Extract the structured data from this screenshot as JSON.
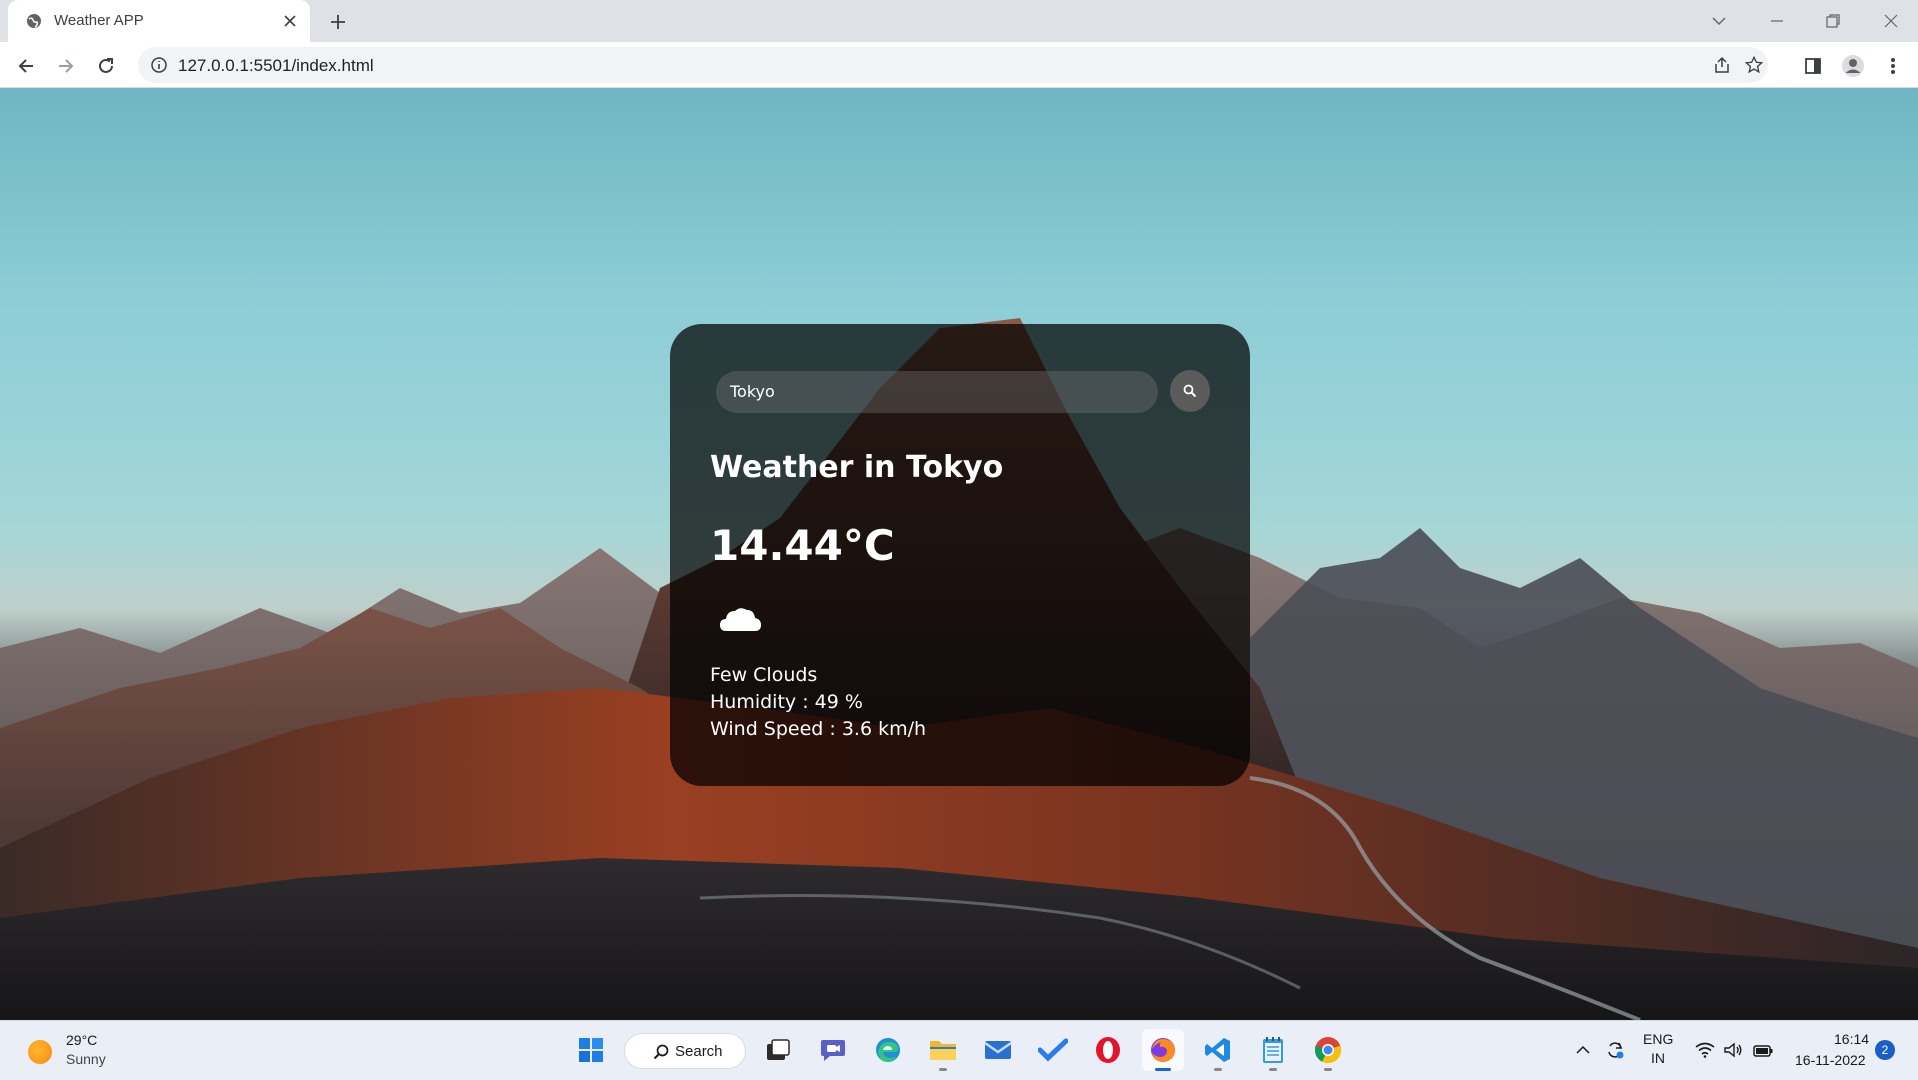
{
  "browser": {
    "tab_title": "Weather APP",
    "url": "127.0.0.1:5501/index.html"
  },
  "weather_card": {
    "search_value": "Tokyo",
    "city_heading": "Weather in Tokyo",
    "temperature": "14.44°C",
    "icon": "cloud-icon",
    "description": "Few Clouds",
    "humidity": "Humidity : 49 %",
    "wind_speed": "Wind Speed : 3.6 km/h"
  },
  "taskbar": {
    "weather_temp": "29°C",
    "weather_condition": "Sunny",
    "search_label": "Search",
    "apps": [
      "start-icon",
      "search",
      "task-view-icon",
      "teams-chat-icon",
      "edge-icon",
      "file-explorer-icon",
      "mail-icon",
      "todo-icon",
      "opera-icon",
      "firefox-icon",
      "vscode-icon",
      "notepad-icon",
      "chrome-icon"
    ],
    "language_line1": "ENG",
    "language_line2": "IN",
    "time": "16:14",
    "date": "16-11-2022",
    "notification_count": "2"
  },
  "colors": {
    "card_background": "rgba(0,0,0,0.72)",
    "taskbar_background": "#e9eef7",
    "tab_strip": "#dee1e6",
    "accent": "#1667d1"
  }
}
